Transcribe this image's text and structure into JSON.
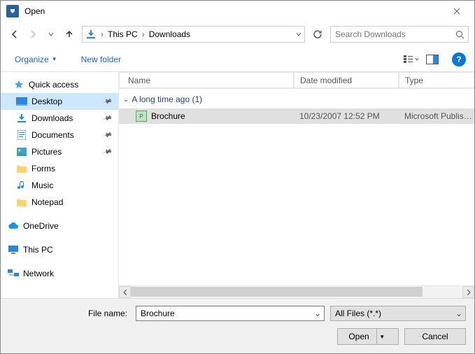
{
  "window": {
    "title": "Open"
  },
  "nav": {
    "breadcrumb": [
      "This PC",
      "Downloads"
    ],
    "search_placeholder": "Search Downloads"
  },
  "toolbar": {
    "organize": "Organize",
    "new_folder": "New folder"
  },
  "sidebar": {
    "quick_access": {
      "label": "Quick access",
      "items": [
        {
          "label": "Desktop",
          "selected": true,
          "pin": true,
          "icon": "desktop"
        },
        {
          "label": "Downloads",
          "pin": true,
          "icon": "downloads"
        },
        {
          "label": "Documents",
          "pin": true,
          "icon": "documents"
        },
        {
          "label": "Pictures",
          "pin": true,
          "icon": "pictures"
        },
        {
          "label": "Forms",
          "icon": "folder"
        },
        {
          "label": "Music",
          "icon": "music"
        },
        {
          "label": "Notepad",
          "icon": "folder"
        }
      ]
    },
    "onedrive": {
      "label": "OneDrive"
    },
    "thispc": {
      "label": "This PC"
    },
    "network": {
      "label": "Network"
    }
  },
  "columns": {
    "name": "Name",
    "date": "Date modified",
    "type": "Type"
  },
  "group": {
    "label": "A long time ago (1)"
  },
  "files": [
    {
      "name": "Brochure",
      "date": "10/23/2007 12:52 PM",
      "type": "Microsoft Publish...",
      "selected": true
    }
  ],
  "footer": {
    "filename_label": "File name:",
    "filename_value": "Brochure",
    "filetype": "All Files (*.*)",
    "open": "Open",
    "cancel": "Cancel"
  }
}
